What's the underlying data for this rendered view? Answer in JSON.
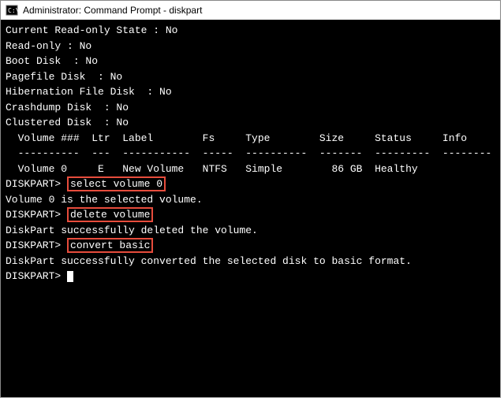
{
  "window": {
    "title": "Administrator: Command Prompt - diskpart"
  },
  "state_lines": [
    {
      "label": "Current Read-only State",
      "value": "No",
      "pad": 24
    },
    {
      "label": "Read-only",
      "value": "No",
      "pad": 10
    },
    {
      "label": "Boot Disk",
      "value": "No",
      "pad": 11
    },
    {
      "label": "Pagefile Disk",
      "value": "No",
      "pad": 15
    },
    {
      "label": "Hibernation File Disk",
      "value": "No",
      "pad": 23
    },
    {
      "label": "Crashdump Disk",
      "value": "No",
      "pad": 16
    },
    {
      "label": "Clustered Disk",
      "value": "No",
      "pad": 16
    }
  ],
  "table": {
    "header": "  Volume ###  Ltr  Label        Fs     Type        Size     Status     Info",
    "divider": "  ----------  ---  -----------  -----  ----------  -------  ---------  --------",
    "row": "  Volume 0     E   New Volume   NTFS   Simple        86 GB  Healthy"
  },
  "prompt": "DISKPART> ",
  "commands": [
    {
      "cmd": "select volume 0",
      "response": "Volume 0 is the selected volume."
    },
    {
      "cmd": "delete volume",
      "response": "DiskPart successfully deleted the volume."
    },
    {
      "cmd": "convert basic",
      "response": "DiskPart successfully converted the selected disk to basic format."
    }
  ]
}
